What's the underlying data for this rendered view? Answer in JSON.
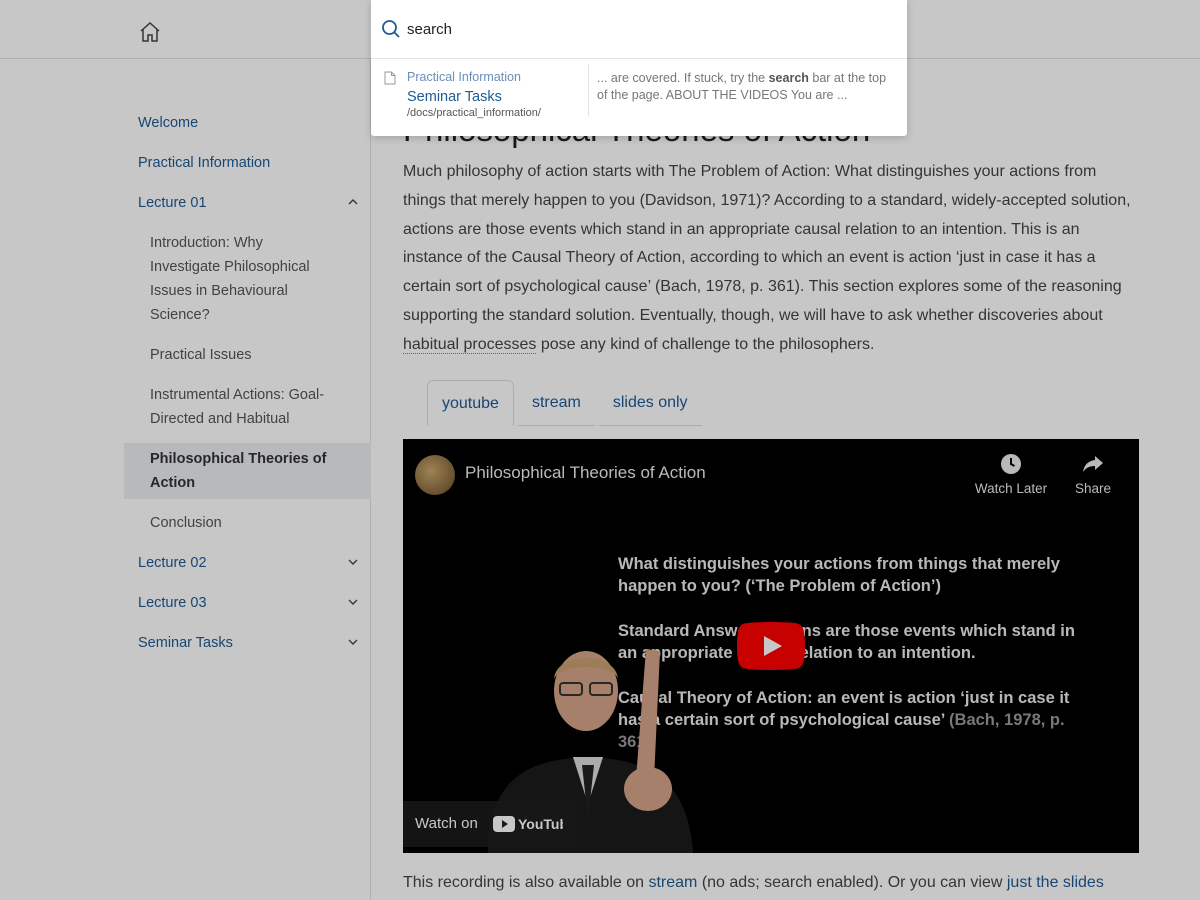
{
  "search": {
    "value": "search",
    "result": {
      "category": "Practical Information",
      "title": "Seminar Tasks",
      "path": "/docs/practical_information/",
      "snippet_before": "... are covered. If stuck, try the ",
      "snippet_highlight": "search",
      "snippet_after": " bar at the top of the page. ABOUT THE VIDEOS You are ..."
    }
  },
  "sidebar": {
    "items": [
      {
        "label": "Welcome"
      },
      {
        "label": "Practical Information"
      },
      {
        "label": "Lecture 01"
      },
      {
        "label": "Lecture 02"
      },
      {
        "label": "Lecture 03"
      },
      {
        "label": "Seminar Tasks"
      }
    ],
    "lecture01_children": [
      {
        "label": "Introduction: Why Investigate Philosophical Issues in Behavioural Science?"
      },
      {
        "label": "Practical Issues"
      },
      {
        "label": "Instrumental Actions: Goal-Directed and Habitual"
      },
      {
        "label": "Philosophical Theories of Action"
      },
      {
        "label": "Conclusion"
      }
    ]
  },
  "main": {
    "title": "Philosophical Theories of Action",
    "intro_part1": "Much philosophy of action starts with The Problem of Action: What distinguishes your actions from things that merely happen to you (Davidson, 1971)? According to a standard, widely-accepted solution, actions are those events which stand in an appropriate causal relation to an intention. This is an instance of the Causal Theory of Action, according to which an event is action ‘just in case it has a certain sort of psychological cause’ (Bach, 1978, p. 361). This section explores some of the reasoning supporting the standard solution. Eventually, though, we will have to ask whether discoveries about ",
    "intro_link": "habitual processes",
    "intro_part2": " pose any kind of challenge to the philosophers.",
    "tabs": [
      {
        "label": "youtube"
      },
      {
        "label": "stream"
      },
      {
        "label": "slides only"
      }
    ],
    "video": {
      "title": "Philosophical Theories of Action",
      "watch_later": "Watch Later",
      "share": "Share",
      "watch_on": "Watch on",
      "youtube_logo": "YouTube",
      "slide_lines": [
        "What distinguishes your actions from things that merely happen to you? (‘The Problem of Action’)",
        "Standard Answer: actions are those events which stand in an appropriate causal relation to an intention.",
        "Causal Theory of Action: an event is action ‘just in case it has a certain sort of psychological cause’ "
      ],
      "slide_citation": "(Bach, 1978, p. 361)",
      "slide_citation_end": "."
    },
    "after_part1": "This recording is also available on ",
    "after_link1": "stream",
    "after_part2": " (no ads; search enabled). Or you can view ",
    "after_link2": "just the slides"
  },
  "colors": {
    "link": "#1f5a93",
    "overlay": "rgba(0,0,0,0.22)",
    "youtube_red": "#ff0000"
  }
}
